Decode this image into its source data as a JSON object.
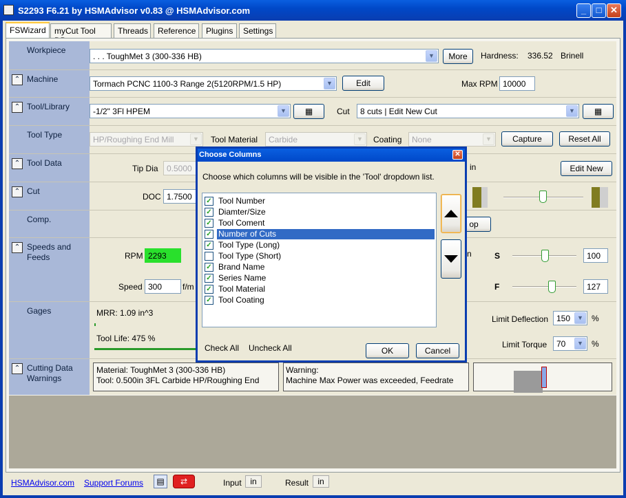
{
  "window": {
    "title": "S2293 F6.21 by HSMAdvisor v0.83 @ HSMAdvisor.com",
    "min": "_",
    "max": "□",
    "close": "✕"
  },
  "tabs": [
    "FSWizard",
    "myCut Tool DB",
    "Threads",
    "Reference",
    "Plugins",
    "Settings"
  ],
  "workpiece": {
    "label": "Workpiece",
    "value": ". . . ToughMet 3 (300-336 HB)",
    "more": "More",
    "hardness_label": "Hardness:",
    "hardness_value": "336.52",
    "hardness_unit": "Brinell"
  },
  "machine": {
    "label": "Machine",
    "value": "Tormach PCNC 1100-3 Range 2(5120RPM/1.5 HP)",
    "edit": "Edit",
    "maxrpm_label": "Max RPM",
    "maxrpm_value": "10000"
  },
  "tool": {
    "label": "Tool/Library",
    "value": "-1/2\" 3Fl  HPEM",
    "cut_label": "Cut",
    "cut_value": "8 cuts | Edit New Cut"
  },
  "tooltype": {
    "label": "Tool Type",
    "value": "HP/Roughing End Mill",
    "material_label": "Tool Material",
    "material_value": "Carbide",
    "coating_label": "Coating",
    "coating_value": "None",
    "capture": "Capture",
    "reset": "Reset All"
  },
  "tooldata": {
    "label": "Tool Data",
    "tipdia_label": "Tip Dia",
    "tipdia_value": "0.5000",
    "unit_in": "in",
    "editnew": "Edit New"
  },
  "cut": {
    "label": "Cut",
    "doc_label": "DOC",
    "doc_value": "1.7500"
  },
  "comp": {
    "label": "Comp.",
    "btn_partial": "op"
  },
  "speeds": {
    "label": "Speeds and Feeds",
    "rpm_label": "RPM",
    "rpm_value": "2293",
    "speed_label": "Speed",
    "speed_value": "300",
    "speed_unit": "f/m",
    "n_partial": "n",
    "s_label": "S",
    "s_value": "100",
    "f_label": "F",
    "f_value": "127"
  },
  "gages": {
    "label": "Gages",
    "mrr": "MRR: 1.09 in^3",
    "toollife": "Tool Life: 475 %",
    "limitdef_label": "Limit Deflection",
    "limitdef_value": "150",
    "limittorque_label": "Limit Torque",
    "limittorque_value": "70",
    "pct": "%"
  },
  "warnings": {
    "label": "Cutting Data Warnings",
    "material_line": "Material: ToughMet 3 (300-336 HB)",
    "tool_line": "Tool: 0.500in 3FL Carbide  HP/Roughing End",
    "warning_title": "Warning:",
    "warning_line": "Machine Max Power was exceeded, Feedrate"
  },
  "status": {
    "site": "HSMAdvisor.com",
    "forums": "Support Forums",
    "input_label": "Input",
    "input_value": "in",
    "result_label": "Result",
    "result_value": "in"
  },
  "dialog": {
    "title": "Choose Columns",
    "close": "✕",
    "instruction": "Choose which columns will be visible in the 'Tool' dropdown list.",
    "columns": [
      {
        "label": "Tool Number",
        "checked": true
      },
      {
        "label": "Diamter/Size",
        "checked": true
      },
      {
        "label": "Tool Coment",
        "checked": true
      },
      {
        "label": "Number of Cuts",
        "checked": true,
        "selected": true
      },
      {
        "label": "Tool Type (Long)",
        "checked": true
      },
      {
        "label": "Tool Type (Short)",
        "checked": false
      },
      {
        "label": "Brand Name",
        "checked": true
      },
      {
        "label": "Series Name",
        "checked": true
      },
      {
        "label": "Tool Material",
        "checked": true
      },
      {
        "label": "Tool Coating",
        "checked": true
      }
    ],
    "check_all": "Check All",
    "uncheck_all": "Uncheck All",
    "ok": "OK",
    "cancel": "Cancel"
  }
}
